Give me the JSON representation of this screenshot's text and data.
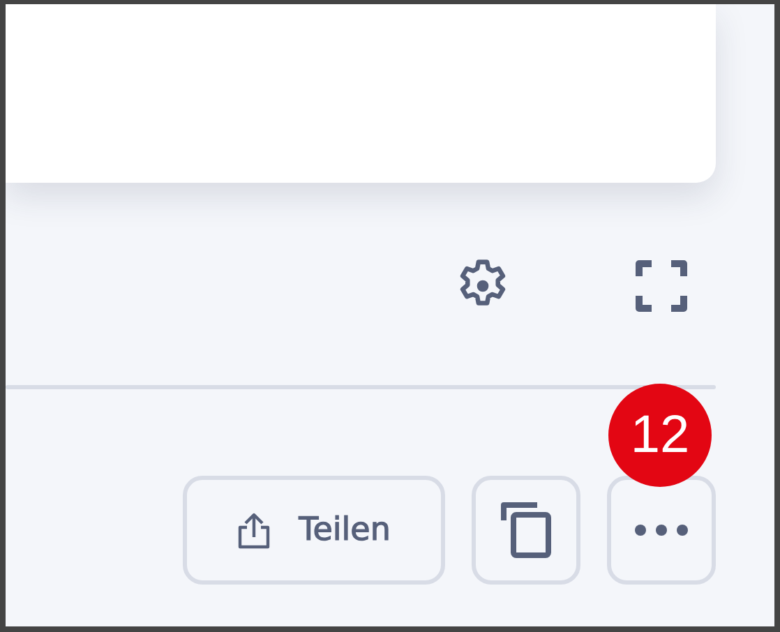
{
  "share_button": {
    "label": "Teilen"
  },
  "more_button": {
    "badge": "12"
  }
}
